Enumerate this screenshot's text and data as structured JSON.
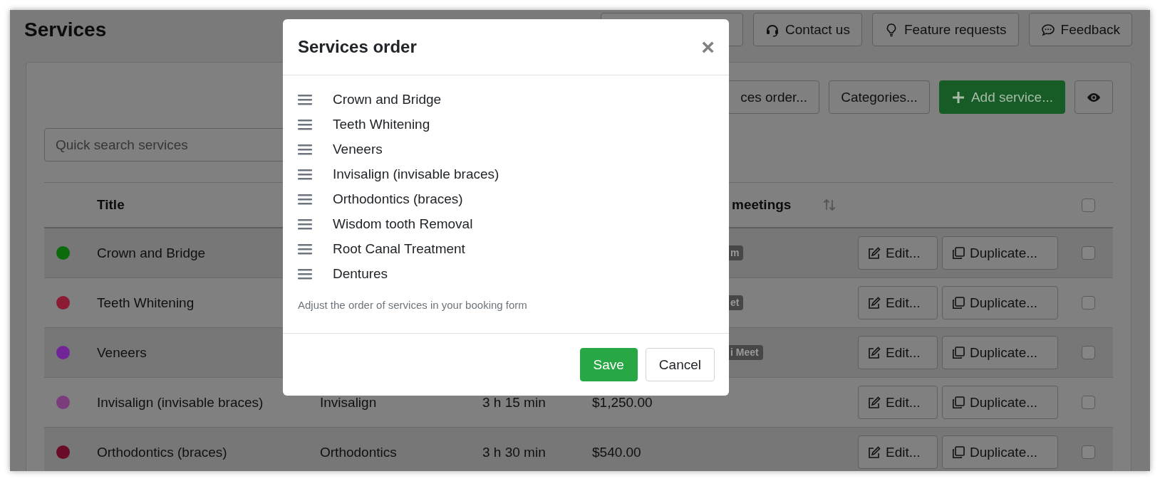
{
  "page": {
    "title": "Services"
  },
  "header_buttons": [
    {
      "kind": "blank"
    },
    {
      "kind": "headset",
      "label": "Contact us"
    },
    {
      "kind": "bulb",
      "label": "Feature requests"
    },
    {
      "kind": "chat",
      "label": "Feedback"
    }
  ],
  "toolbar": [
    {
      "kind": "clipped",
      "label": "ces order..."
    },
    {
      "kind": "plain",
      "label": "Categories..."
    },
    {
      "kind": "primary",
      "label": "Add service..."
    },
    {
      "kind": "eye"
    }
  ],
  "search": {
    "placeholder": "Quick search services"
  },
  "table": {
    "columns": [
      {
        "label": "Title"
      },
      {
        "label": "meetings",
        "sortable": true
      }
    ],
    "header_checked": false,
    "rows": [
      {
        "color": "#0b6a0b",
        "title": "Crown and Bridge",
        "badge": "m",
        "edit": "Edit...",
        "duplicate": "Duplicate...",
        "checked": false
      },
      {
        "color": "#8b1c33",
        "title": "Teeth Whitening",
        "badge": "et",
        "edit": "Edit...",
        "duplicate": "Duplicate...",
        "checked": false
      },
      {
        "color": "#722598",
        "title": "Veneers",
        "badge": "i Meet",
        "edit": "Edit...",
        "duplicate": "Duplicate...",
        "checked": false
      },
      {
        "color": "#7c3d7c",
        "title": "Invisalign (invisable braces)",
        "type": "Invisalign",
        "duration": "3 h 15 min",
        "price": "$1,250.00",
        "edit": "Edit...",
        "duplicate": "Duplicate...",
        "checked": false
      },
      {
        "color": "#6a0c27",
        "title": "Orthodontics (braces)",
        "type": "Orthodontics",
        "duration": "3 h 30 min",
        "price": "$540.00",
        "edit": "Edit...",
        "duplicate": "Duplicate...",
        "checked": false
      }
    ]
  },
  "modal": {
    "title": "Services order",
    "close": "×",
    "items": [
      "Crown and Bridge",
      "Teeth Whitening",
      "Veneers",
      "Invisalign (invisable braces)",
      "Orthodontics (braces)",
      "Wisdom tooth Removal",
      "Root Canal Treatment",
      "Dentures"
    ],
    "help": "Adjust the order of services in your booking form",
    "buttons": [
      {
        "kind": "primary",
        "label": "Save"
      },
      {
        "kind": "secondary",
        "label": "Cancel"
      }
    ]
  }
}
